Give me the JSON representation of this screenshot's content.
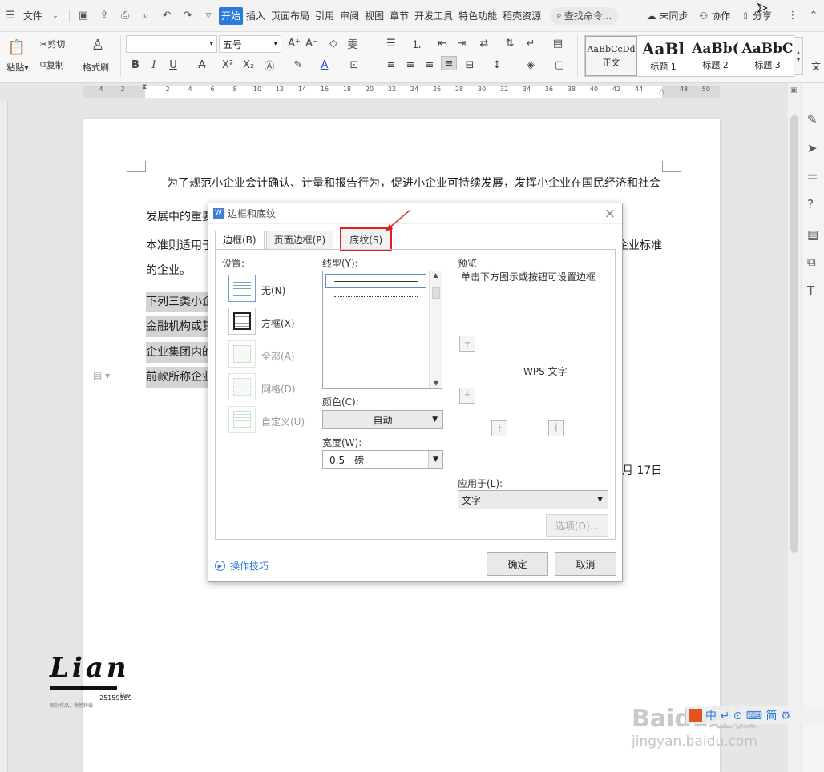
{
  "menubar": {
    "file": "文件",
    "tabs": [
      "开始",
      "插入",
      "页面布局",
      "引用",
      "审阅",
      "视图",
      "章节",
      "开发工具",
      "特色功能",
      "稻壳资源"
    ],
    "search": "查找命令...",
    "sync": "未同步",
    "collab": "协作",
    "share": "分享"
  },
  "ribbon": {
    "paste": "粘贴",
    "cut": "剪切",
    "copy": "复制",
    "format_painter": "格式刷",
    "font_name": "",
    "font_size": "五号",
    "styles": [
      {
        "preview": "AaBbCcDd",
        "name": "正文"
      },
      {
        "preview": "AaBl",
        "name": "标题 1"
      },
      {
        "preview": "AaBb(",
        "name": "标题 2"
      },
      {
        "preview": "AaBbC",
        "name": "标题 3"
      }
    ],
    "text_tail": "文"
  },
  "ruler": {
    "ticks": [
      "4",
      "2",
      "2",
      "4",
      "6",
      "8",
      "10",
      "12",
      "14",
      "16",
      "18",
      "20",
      "22",
      "24",
      "26",
      "28",
      "30",
      "32",
      "34",
      "36",
      "38",
      "40",
      "42",
      "44",
      "48",
      "50"
    ]
  },
  "document": {
    "lines": [
      "为了规范小企业会计确认、计量和报告行为，促进小企业可持续发展，发挥小企业在国民经济和社会",
      "发展中的重要",
      "本准则适用于",
      "企业标准",
      "的企业。",
      "下列三类小企",
      "金融机构或其",
      "企业集团内的",
      "前款所称企业",
      "月 17日"
    ]
  },
  "dialog": {
    "title": "边框和底纹",
    "tabs": [
      "边框(B)",
      "页面边框(P)",
      "底纹(S)"
    ],
    "settings_label": "设置:",
    "settings": [
      "无(N)",
      "方框(X)",
      "全部(A)",
      "网格(D)",
      "自定义(U)"
    ],
    "line_style_label": "线型(Y):",
    "color_label": "颜色(C):",
    "color_value": "自动",
    "width_label": "宽度(W):",
    "width_value": "0.5　磅",
    "preview_label": "预览",
    "preview_hint": "单击下方图示或按钮可设置边框",
    "preview_text": "WPS 文字",
    "apply_label": "应用于(L):",
    "apply_value": "文字",
    "options_button": "选项(O)...",
    "tips": "操作技巧",
    "ok": "确定",
    "cancel": "取消"
  },
  "watermark": {
    "logo": "Lian",
    "sub": "Lian",
    "number": "25159569",
    "note": "原创作品，谢绝转载"
  },
  "baidu": {
    "logo": "Baidu经验",
    "url": "jingyan.baidu.com",
    "ime": "中 ↵ ⊙ ⌨ 简 ⚙"
  },
  "colors": {
    "accent": "#2b79d8",
    "highlight_box": "#e01e1e"
  }
}
